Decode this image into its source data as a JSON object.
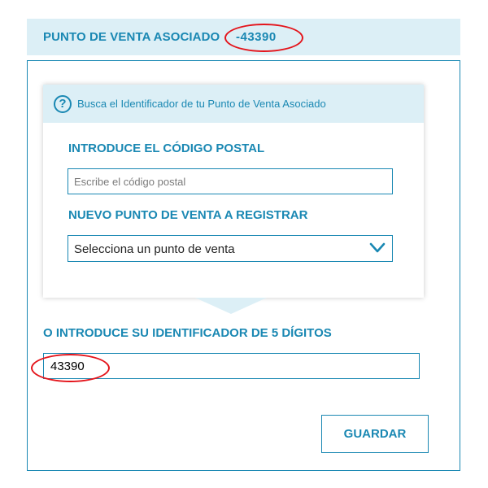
{
  "header": {
    "title": "PUNTO DE VENTA ASOCIADO",
    "associated_id": "-43390"
  },
  "search_card": {
    "help_text": "Busca el Identificador de tu Punto de Venta Asociado",
    "postal_code": {
      "label": "INTRODUCE EL CÓDIGO POSTAL",
      "placeholder": "Escribe el código postal",
      "value": ""
    },
    "new_point": {
      "label": "NUEVO PUNTO DE VENTA A REGISTRAR",
      "selected": "Selecciona un punto de venta"
    }
  },
  "identifier": {
    "label": "O INTRODUCE SU IDENTIFICADOR DE 5 DÍGITOS",
    "value": "43390"
  },
  "actions": {
    "save_label": "GUARDAR"
  },
  "colors": {
    "accent": "#1a88b3",
    "panel_background": "#dceff6",
    "annotation": "#e4141b"
  },
  "icons": {
    "help": "question-circle-icon",
    "dropdown": "chevron-down-icon"
  }
}
